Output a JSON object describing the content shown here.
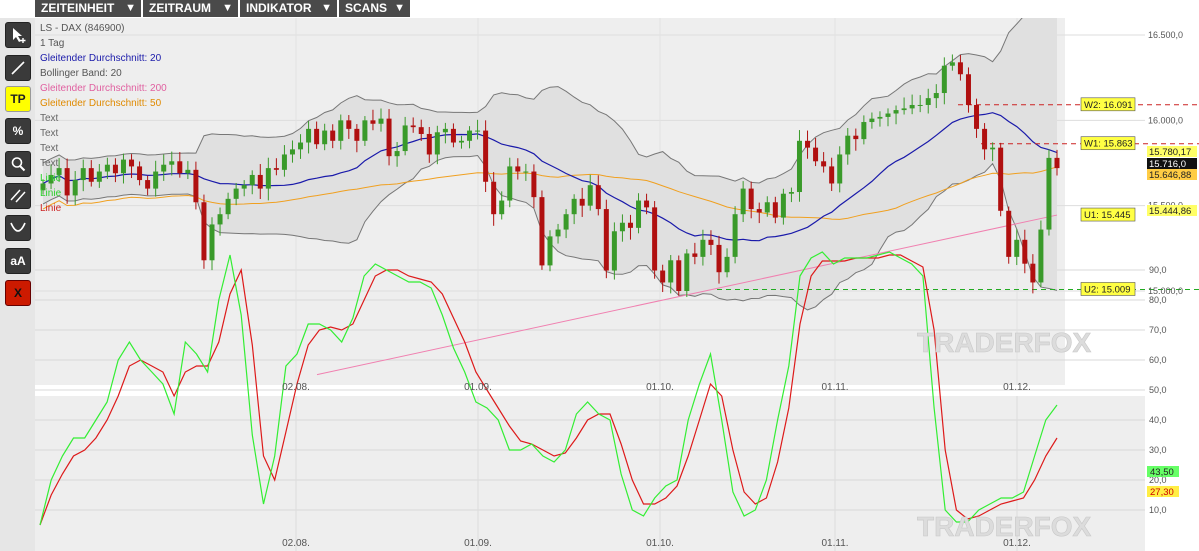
{
  "menu": [
    {
      "label": "ZEITEINHEIT"
    },
    {
      "label": "ZEITRAUM"
    },
    {
      "label": "INDIKATOR"
    },
    {
      "label": "SCANS"
    }
  ],
  "toolbar": {
    "tp_label": "TP",
    "percent_label": "%",
    "font_label": "aA",
    "close_label": "X"
  },
  "header": {
    "instrument": "LS - DAX (846900)",
    "timeframe": "1 Tag"
  },
  "legend": [
    {
      "label": "Gleitender Durchschnitt: 20",
      "color": "#1a1aaa"
    },
    {
      "label": "Bollinger Band: 20",
      "color": "#555555"
    },
    {
      "label": "Gleitender Durchschnitt: 200",
      "color": "#e060a0"
    },
    {
      "label": "Gleitender Durchschnitt: 50",
      "color": "#e08a00"
    },
    {
      "label": "Text",
      "color": "#666666"
    },
    {
      "label": "Text",
      "color": "#666666"
    },
    {
      "label": "Text",
      "color": "#666666"
    },
    {
      "label": "Text",
      "color": "#666666"
    },
    {
      "label": "Linie",
      "color": "#2bd12b"
    },
    {
      "label": "Linie",
      "color": "#2bd12b"
    },
    {
      "label": "Linie",
      "color": "#cc2222"
    }
  ],
  "watermark": "TRADERFOX",
  "chart_data": [
    {
      "type": "candlestick",
      "x_tick_labels": [
        "02.08.",
        "01.09.",
        "01.10.",
        "01.11.",
        "01.12."
      ],
      "y_ticks": [
        "16.500,0",
        "16.000,0",
        "15.500,0",
        "15.000,0"
      ],
      "ylim": [
        14500,
        16600
      ],
      "close": [
        15630,
        15680,
        15720,
        15560,
        15650,
        15720,
        15640,
        15700,
        15740,
        15690,
        15770,
        15730,
        15650,
        15600,
        15700,
        15740,
        15760,
        15690,
        15710,
        15520,
        15180,
        15390,
        15450,
        15540,
        15600,
        15620,
        15680,
        15600,
        15720,
        15710,
        15800,
        15830,
        15870,
        15950,
        15860,
        15940,
        15880,
        16000,
        15950,
        15880,
        16000,
        15980,
        16010,
        15790,
        15820,
        15970,
        15960,
        15920,
        15800,
        15930,
        15950,
        15870,
        15880,
        15940,
        15940,
        15640,
        15450,
        15530,
        15730,
        15700,
        15700,
        15550,
        15150,
        15320,
        15360,
        15450,
        15540,
        15500,
        15620,
        15480,
        15120,
        15350,
        15400,
        15370,
        15530,
        15490,
        15120,
        15050,
        15180,
        15000,
        15220,
        15200,
        15300,
        15270,
        15110,
        15200,
        15450,
        15600,
        15480,
        15460,
        15520,
        15430,
        15570,
        15580,
        15880,
        15840,
        15760,
        15730,
        15630,
        15800,
        15910,
        15890,
        15990,
        16010,
        16020,
        16040,
        16060,
        16070,
        16090,
        16090,
        16130,
        16160,
        16320,
        16340,
        16270,
        16090,
        15950,
        15830,
        15840,
        15470,
        15200,
        15300,
        15160,
        15050,
        15360,
        15780,
        15720
      ],
      "ma20_endpoints": [
        15640,
        15740
      ],
      "ma50_endpoints": [
        15420,
        15649
      ],
      "ma200_endpoints": [
        14920,
        15445
      ],
      "bollinger_upper_endpoints": [
        15850,
        16600
      ],
      "bollinger_lower_endpoints": [
        15430,
        14990
      ],
      "levels": [
        {
          "label": "W2: 16.091",
          "value": 16091,
          "color": "#cc2222"
        },
        {
          "label": "W1: 15.863",
          "value": 15863,
          "color": "#cc2222"
        },
        {
          "label": "U1: 15.445",
          "value": 15445,
          "color": "#cc2222"
        },
        {
          "label": "U2: 15.009",
          "value": 15009,
          "color": "#22aa22"
        }
      ],
      "price_tags": [
        {
          "text": "15.780,17",
          "bg": "#ffff66",
          "fg": "#222222"
        },
        {
          "text": "15.716,0",
          "bg": "#111111",
          "fg": "#ffffff"
        },
        {
          "text": "15.646,88",
          "bg": "#ffcc44",
          "fg": "#222222"
        },
        {
          "text": "15.444,86",
          "bg": "#ffff66",
          "fg": "#222222"
        }
      ]
    },
    {
      "type": "line",
      "name": "oscillator",
      "y_ticks": [
        "90,0",
        "80,0",
        "70,0",
        "60,0",
        "50,0",
        "40,0",
        "30,0",
        "20,0",
        "10,0"
      ],
      "ylim": [
        0,
        100
      ],
      "fast": [
        5,
        20,
        28,
        34,
        34,
        40,
        46,
        60,
        66,
        60,
        56,
        52,
        42,
        66,
        62,
        56,
        80,
        95,
        75,
        35,
        12,
        28,
        58,
        62,
        72,
        72,
        70,
        66,
        74,
        88,
        92,
        90,
        88,
        86,
        86,
        84,
        75,
        64,
        56,
        46,
        44,
        40,
        30,
        30,
        32,
        28,
        26,
        30,
        42,
        46,
        42,
        40,
        22,
        10,
        8,
        14,
        18,
        20,
        40,
        52,
        62,
        40,
        16,
        8,
        10,
        20,
        40,
        58,
        88,
        94,
        96,
        92,
        94,
        94,
        94,
        95,
        96,
        94,
        92,
        88,
        44,
        10,
        6,
        6,
        10,
        12,
        14,
        14,
        16,
        28,
        40,
        45
      ],
      "slow": [
        5,
        15,
        22,
        28,
        30,
        34,
        40,
        48,
        58,
        60,
        58,
        56,
        48,
        56,
        58,
        58,
        66,
        82,
        90,
        65,
        28,
        20,
        36,
        52,
        65,
        70,
        71,
        70,
        72,
        80,
        88,
        90,
        90,
        88,
        87,
        86,
        82,
        74,
        66,
        56,
        50,
        44,
        38,
        33,
        32,
        30,
        28,
        29,
        34,
        40,
        42,
        42,
        32,
        20,
        12,
        12,
        14,
        18,
        28,
        40,
        52,
        48,
        30,
        16,
        12,
        14,
        26,
        44,
        72,
        88,
        93,
        93,
        93,
        94,
        94,
        94,
        95,
        95,
        93,
        91,
        70,
        30,
        10,
        7,
        8,
        10,
        12,
        13,
        14,
        20,
        28,
        34
      ],
      "tags": [
        {
          "text": "43,50",
          "bg": "#66ff66",
          "fg": "#222222"
        },
        {
          "text": "27,30",
          "bg": "#ffee44",
          "fg": "#cc0000"
        }
      ]
    }
  ],
  "colors": {
    "up": "#3a9a2a",
    "down": "#b01010",
    "band_fill": "#e0e0e0",
    "ma20": "#1a1aaa",
    "ma50": "#f0a020",
    "ma200": "#f080b0",
    "osc_fast": "#33ee33",
    "osc_slow": "#dd1a1a"
  }
}
